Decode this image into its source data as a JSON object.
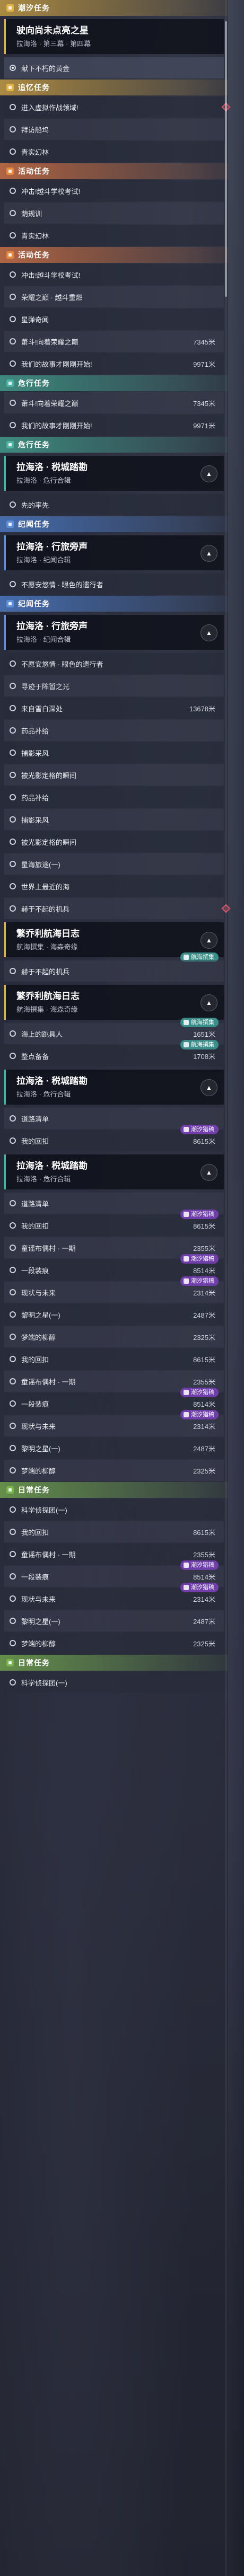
{
  "scrollbar": {
    "visible": true
  },
  "sections": [
    {
      "kind": "header",
      "color": "gold",
      "label": "潮汐任务",
      "icon": "tide-quest-icon"
    },
    {
      "kind": "card",
      "border": "gold",
      "title": "驶向尚未点亮之星",
      "subtitle": "拉海洛 · 第三幕 · 第四幕",
      "expand": false
    },
    {
      "kind": "task",
      "label": "献下不朽的黄金",
      "dist": "",
      "active": true,
      "bullet": "filled"
    },
    {
      "kind": "header",
      "color": "gold",
      "label": "追忆任务",
      "icon": "memory-quest-icon"
    },
    {
      "kind": "task",
      "label": "进入虚拟作战领域!",
      "dist": "",
      "arrow": true
    },
    {
      "kind": "task",
      "label": "拜访船坞",
      "dist": "",
      "alt": true
    },
    {
      "kind": "task",
      "label": "青实幻林",
      "dist": ""
    },
    {
      "kind": "header",
      "color": "orange",
      "label": "活动任务",
      "icon": "event-quest-icon"
    },
    {
      "kind": "task",
      "label": "冲击!越斗学校考试!",
      "dist": ""
    },
    {
      "kind": "task",
      "label": "荫规训",
      "dist": "",
      "alt": true
    },
    {
      "kind": "task",
      "label": "青实幻林",
      "dist": ""
    },
    {
      "kind": "header",
      "color": "orange",
      "label": "活动任务",
      "icon": "event-quest-icon"
    },
    {
      "kind": "task",
      "label": "冲击!越斗学校考试!",
      "dist": ""
    },
    {
      "kind": "task",
      "label": "荣耀之巅 · 越斗重燃",
      "dist": "",
      "alt": true
    },
    {
      "kind": "task",
      "label": "星弹奇闻",
      "dist": ""
    },
    {
      "kind": "task",
      "label": "萧斗!向着荣耀之巅",
      "dist": "7345米",
      "alt": true
    },
    {
      "kind": "task",
      "label": "我们的故事才刚刚开始!",
      "dist": "9971米"
    },
    {
      "kind": "header",
      "color": "teal",
      "label": "危行任务",
      "icon": "danger-quest-icon"
    },
    {
      "kind": "task",
      "label": "萧斗!向着荣耀之巅",
      "dist": "7345米",
      "alt": true
    },
    {
      "kind": "task",
      "label": "我们的故事才刚刚开始!",
      "dist": "9971米"
    },
    {
      "kind": "header",
      "color": "teal",
      "label": "危行任务",
      "icon": "danger-quest-icon"
    },
    {
      "kind": "card",
      "border": "teal",
      "title": "拉海洛 · 税城踏勘",
      "subtitle": "拉海洛 · 危行合辑",
      "expand": true
    },
    {
      "kind": "task",
      "label": "先的率先",
      "dist": ""
    },
    {
      "kind": "header",
      "color": "blue",
      "label": "纪闻任务",
      "icon": "chronicle-quest-icon"
    },
    {
      "kind": "card",
      "border": "blue",
      "title": "拉海洛 · 行旅旁声",
      "subtitle": "拉海洛 · 纪闻合辑",
      "expand": true
    },
    {
      "kind": "task",
      "label": "不愿安悠情 · 眼色的遗行者",
      "dist": ""
    },
    {
      "kind": "header",
      "color": "blue",
      "label": "纪闻任务",
      "icon": "chronicle-quest-icon"
    },
    {
      "kind": "card",
      "border": "blue",
      "title": "拉海洛 · 行旅旁声",
      "subtitle": "拉海洛 · 纪闻合辑",
      "expand": true
    },
    {
      "kind": "task",
      "label": "不愿安悠情 · 眼色的遗行者",
      "dist": ""
    },
    {
      "kind": "task",
      "label": "寻迹于阵暂之光",
      "dist": "",
      "alt": true
    },
    {
      "kind": "task",
      "label": "来自雪白深处",
      "dist": "13678米"
    },
    {
      "kind": "task",
      "label": "药品补给",
      "dist": "",
      "alt": true
    },
    {
      "kind": "task",
      "label": "捕影采风",
      "dist": ""
    },
    {
      "kind": "task",
      "label": "被光影定格的瞬间",
      "dist": "",
      "alt": true
    },
    {
      "kind": "task",
      "label": "药品补给",
      "dist": ""
    },
    {
      "kind": "task",
      "label": "捕影采风",
      "dist": "",
      "alt": true
    },
    {
      "kind": "task",
      "label": "被光影定格的瞬间",
      "dist": ""
    },
    {
      "kind": "task",
      "label": "星海旅途(一)",
      "dist": "",
      "alt": true
    },
    {
      "kind": "task",
      "label": "世界上最近的海",
      "dist": ""
    },
    {
      "kind": "task",
      "label": "赫于不起的机兵",
      "dist": "",
      "alt": true,
      "arrow": true
    },
    {
      "kind": "card",
      "border": "gold",
      "title": "繁乔利航海日志",
      "subtitle": "航海撰集 · 海森奇缘",
      "expand": true,
      "tag": {
        "text": "航海撰集",
        "color": "teal"
      }
    },
    {
      "kind": "task",
      "label": "赫于不起的机兵",
      "dist": "",
      "alt": true
    },
    {
      "kind": "card",
      "border": "gold",
      "title": "繁乔利航海日志",
      "subtitle": "航海撰集 · 海森奇缘",
      "expand": true
    },
    {
      "kind": "task",
      "label": "海上的跳具人",
      "dist": "1651米",
      "alt": true,
      "tag": {
        "text": "航海撰集",
        "color": "teal"
      }
    },
    {
      "kind": "task",
      "label": "整点备备",
      "dist": "1708米",
      "tag": {
        "text": "航海撰集",
        "color": "teal"
      }
    },
    {
      "kind": "card",
      "border": "teal",
      "title": "拉海洛 · 税城踏勘",
      "subtitle": "拉海洛 · 危行合辑",
      "expand": true
    },
    {
      "kind": "task",
      "label": "道路清单",
      "dist": "",
      "alt": true
    },
    {
      "kind": "task",
      "label": "我的回扣",
      "dist": "8615米",
      "tag": {
        "text": "潮汐猎稿",
        "color": "purple"
      }
    },
    {
      "kind": "card",
      "border": "teal",
      "title": "拉海洛 · 税城踏勘",
      "subtitle": "拉海洛 · 危行合辑",
      "expand": true
    },
    {
      "kind": "task",
      "label": "道路清单",
      "dist": "",
      "alt": true
    },
    {
      "kind": "task",
      "label": "我的回扣",
      "dist": "8615米",
      "tag": {
        "text": "潮汐猎稿",
        "color": "purple"
      }
    },
    {
      "kind": "task",
      "label": "童谣布偶村 · 一期",
      "dist": "2355米",
      "alt": true
    },
    {
      "kind": "task",
      "label": "一段装痕",
      "dist": "8514米",
      "tag": {
        "text": "潮汐猎稿",
        "color": "purple"
      }
    },
    {
      "kind": "task",
      "label": "现状与未来",
      "dist": "2314米",
      "alt": true,
      "tag": {
        "text": "潮汐猎稿",
        "color": "purple"
      }
    },
    {
      "kind": "task",
      "label": "黎明之星(一)",
      "dist": "2487米"
    },
    {
      "kind": "task",
      "label": "梦端的柳醇",
      "dist": "2325米",
      "alt": true
    },
    {
      "kind": "task",
      "label": "我的回扣",
      "dist": "8615米"
    },
    {
      "kind": "task",
      "label": "童谣布偶村 · 一期",
      "dist": "2355米",
      "alt": true
    },
    {
      "kind": "task",
      "label": "一段装痕",
      "dist": "8514米",
      "tag": {
        "text": "潮汐猎稿",
        "color": "purple"
      }
    },
    {
      "kind": "task",
      "label": "现状与未来",
      "dist": "2314米",
      "alt": true,
      "tag": {
        "text": "潮汐猎稿",
        "color": "purple"
      }
    },
    {
      "kind": "task",
      "label": "黎明之星(一)",
      "dist": "2487米"
    },
    {
      "kind": "task",
      "label": "梦端的柳醇",
      "dist": "2325米",
      "alt": true
    },
    {
      "kind": "header",
      "color": "green",
      "label": "日常任务",
      "icon": "daily-quest-icon"
    },
    {
      "kind": "task",
      "label": "科学侦探团(一)",
      "dist": ""
    },
    {
      "kind": "task",
      "label": "我的回扣",
      "dist": "8615米",
      "alt": true
    },
    {
      "kind": "task",
      "label": "童谣布偶村 · 一期",
      "dist": "2355米"
    },
    {
      "kind": "task",
      "label": "一段装痕",
      "dist": "8514米",
      "alt": true,
      "tag": {
        "text": "潮汐猎稿",
        "color": "purple"
      }
    },
    {
      "kind": "task",
      "label": "现状与未来",
      "dist": "2314米",
      "tag": {
        "text": "潮汐猎稿",
        "color": "purple"
      }
    },
    {
      "kind": "task",
      "label": "黎明之星(一)",
      "dist": "2487米",
      "alt": true
    },
    {
      "kind": "task",
      "label": "梦端的柳醇",
      "dist": "2325米"
    },
    {
      "kind": "header",
      "color": "green",
      "label": "日常任务",
      "icon": "daily-quest-icon"
    },
    {
      "kind": "task",
      "label": "科学侦探团(一)",
      "dist": ""
    }
  ]
}
